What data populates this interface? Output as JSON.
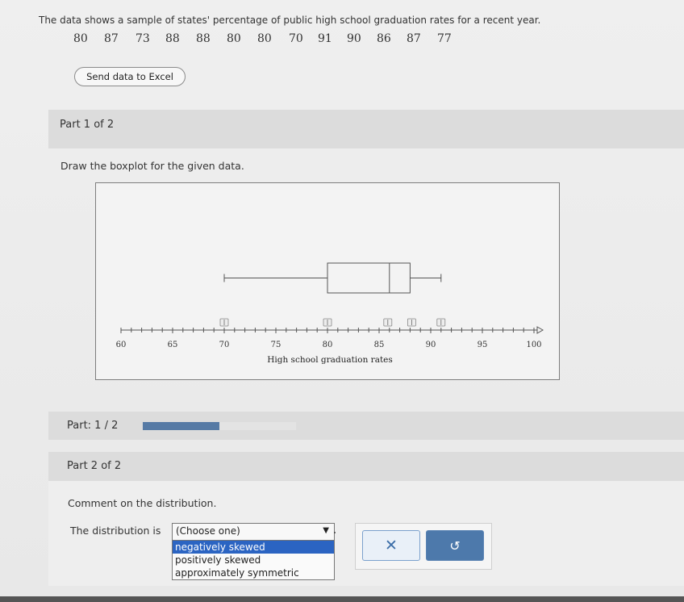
{
  "question": {
    "prompt": "The data shows a sample of states' percentage of public high school graduation rates for a recent year.",
    "values": [
      "80",
      "87",
      "73",
      "88",
      "88",
      "80",
      "80",
      "70",
      "91",
      "90",
      "86",
      "87",
      "77"
    ],
    "excel_button": "Send data to Excel"
  },
  "part1": {
    "title": "Part 1 of 2",
    "instruction": "Draw the boxplot for the given data."
  },
  "chart_data": {
    "type": "boxplot",
    "orientation": "horizontal",
    "min": 70,
    "q1": 80,
    "median": 86,
    "q3": 88,
    "max": 91,
    "xlim": [
      60,
      100
    ],
    "tick_labels": [
      "60",
      "65",
      "70",
      "75",
      "80",
      "85",
      "90",
      "95",
      "100"
    ],
    "xlabel": "High school graduation rates",
    "handle_icon": "drag-handle-icon"
  },
  "progress": {
    "label": "Part: 1 / 2",
    "fraction": 0.5,
    "fill_color": "#567aa5"
  },
  "part2": {
    "title": "Part 2 of 2",
    "instruction": "Comment on the distribution.",
    "sentence_start": "The distribution is",
    "select": {
      "placeholder": "(Choose one)",
      "options": [
        "negatively skewed",
        "positively skewed",
        "approximately symmetric"
      ],
      "highlighted_index": 0
    },
    "buttons": {
      "clear_icon": "x-icon",
      "clear_symbol": "✕",
      "undo_icon": "undo-icon",
      "undo_symbol": "↺"
    }
  }
}
